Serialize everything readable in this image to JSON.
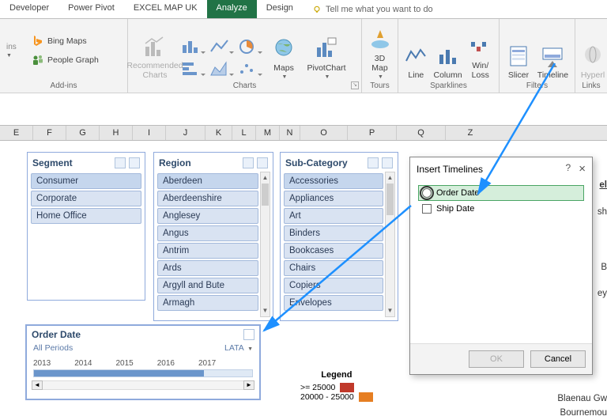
{
  "tabs": [
    "Developer",
    "Power Pivot",
    "EXCEL MAP UK",
    "Analyze",
    "Design"
  ],
  "active_tab": 3,
  "tellme": "Tell me what you want to do",
  "ribbon": {
    "addins": {
      "bing": "Bing Maps",
      "people": "People Graph",
      "dropdown": "ins",
      "label": "Add-ins"
    },
    "charts": {
      "rec": "Recommended\nCharts",
      "maps": "Maps",
      "pivot": "PivotChart",
      "label": "Charts"
    },
    "tours": {
      "map3d": "3D\nMap",
      "label": "Tours"
    },
    "spark": {
      "line": "Line",
      "col": "Column",
      "wl": "Win/\nLoss",
      "label": "Sparklines"
    },
    "filters": {
      "slicer": "Slicer",
      "timeline": "Timeline",
      "label": "Filters"
    },
    "links": {
      "hyper": "Hyperl",
      "label": "Links"
    }
  },
  "cols": [
    "E",
    "F",
    "G",
    "H",
    "I",
    "J",
    "K",
    "L",
    "M",
    "N",
    "O",
    "P",
    "Q",
    "Z"
  ],
  "slicers": {
    "segment": {
      "title": "Segment",
      "items": [
        "Consumer",
        "Corporate",
        "Home Office"
      ]
    },
    "region": {
      "title": "Region",
      "items": [
        "Aberdeen",
        "Aberdeenshire",
        "Anglesey",
        "Angus",
        "Antrim",
        "Ards",
        "Argyll and Bute",
        "Armagh"
      ]
    },
    "subcat": {
      "title": "Sub-Category",
      "items": [
        "Accessories",
        "Appliances",
        "Art",
        "Binders",
        "Bookcases",
        "Chairs",
        "Copiers",
        "Envelopes"
      ]
    }
  },
  "timeline": {
    "title": "Order Date",
    "period": "All Periods",
    "level": "LATA",
    "years": [
      "2013",
      "2014",
      "2015",
      "2016",
      "2017"
    ]
  },
  "dialog": {
    "title": "Insert Timelines",
    "items": [
      "Order Date",
      "Ship Date"
    ],
    "ok": "OK",
    "cancel": "Cancel",
    "help": "?",
    "close": "×"
  },
  "legend": {
    "title": "Legend",
    "r1": ">=   25000",
    "r2": "20000 - 25000"
  },
  "edge": [
    "el",
    "sh",
    "B",
    "ey",
    "Blaenau Gw",
    "Bournemou"
  ]
}
